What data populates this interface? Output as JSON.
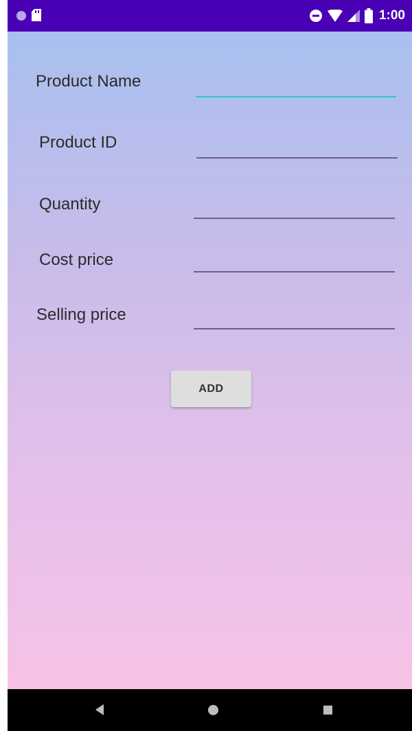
{
  "status_bar": {
    "time": "1:00",
    "icons": [
      "notification-dot-icon",
      "sd-card-icon",
      "do-not-disturb-icon",
      "wifi-icon",
      "cellular-signal-icon",
      "battery-icon"
    ]
  },
  "form": {
    "fields": [
      {
        "label": "Product Name",
        "value": "",
        "focused": true
      },
      {
        "label": "Product ID",
        "value": ""
      },
      {
        "label": "Quantity",
        "value": ""
      },
      {
        "label": "Cost price",
        "value": ""
      },
      {
        "label": "Selling price",
        "value": ""
      }
    ],
    "add_label": "ADD"
  },
  "nav_bar": {
    "icons": [
      "back-icon",
      "home-icon",
      "recents-icon"
    ]
  },
  "colors": {
    "status_bar": "#4a00b5",
    "focused_underline": "#2ec4cc",
    "gradient_top": "#a8c0ef",
    "gradient_bottom": "#f7c2e6"
  }
}
